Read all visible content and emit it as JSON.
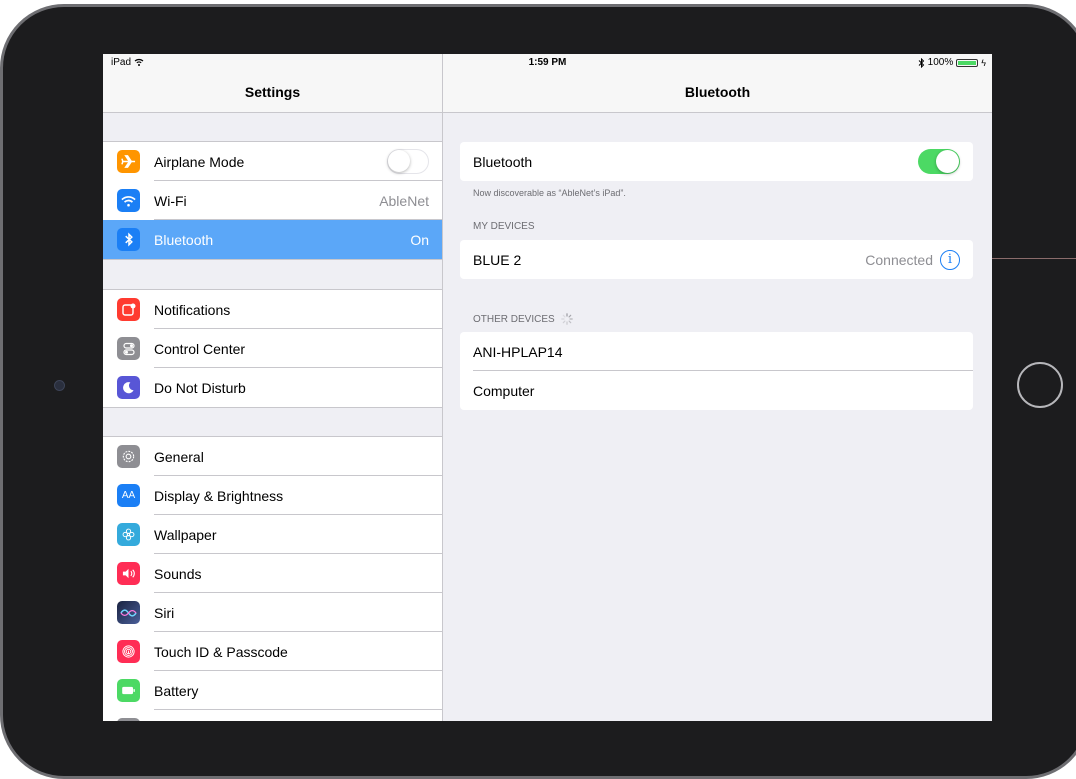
{
  "status_bar": {
    "device": "iPad",
    "time": "1:59 PM",
    "battery": "100%",
    "battery_level": 1.0
  },
  "master": {
    "title": "Settings",
    "groups": [
      [
        {
          "label": "Airplane Mode",
          "icon": "airplane-icon",
          "color": "#ff9500",
          "toggle": "off"
        },
        {
          "label": "Wi-Fi",
          "icon": "wifi-icon",
          "color": "#1b7ff5",
          "value": "AbleNet"
        },
        {
          "label": "Bluetooth",
          "icon": "bluetooth-icon",
          "color": "#1b7ff5",
          "value": "On",
          "selected": true
        }
      ],
      [
        {
          "label": "Notifications",
          "icon": "notifications-icon",
          "color": "#ff3b30"
        },
        {
          "label": "Control Center",
          "icon": "control-center-icon",
          "color": "#8e8e93"
        },
        {
          "label": "Do Not Disturb",
          "icon": "moon-icon",
          "color": "#5856d6"
        }
      ],
      [
        {
          "label": "General",
          "icon": "gear-icon",
          "color": "#8e8e93"
        },
        {
          "label": "Display & Brightness",
          "icon": "display-icon",
          "color": "#1b7ff5"
        },
        {
          "label": "Wallpaper",
          "icon": "wallpaper-icon",
          "color": "#34aadc"
        },
        {
          "label": "Sounds",
          "icon": "sounds-icon",
          "color": "#ff2d55"
        },
        {
          "label": "Siri",
          "icon": "siri-icon",
          "color": "#2d3a5c"
        },
        {
          "label": "Touch ID & Passcode",
          "icon": "fingerprint-icon",
          "color": "#ff2d55"
        },
        {
          "label": "Battery",
          "icon": "battery-icon",
          "color": "#4cd964"
        }
      ]
    ]
  },
  "detail": {
    "title": "Bluetooth",
    "toggle_label": "Bluetooth",
    "toggle_state": "on",
    "discoverable_note": "Now discoverable as “AbleNet’s iPad”.",
    "my_devices_header": "MY DEVICES",
    "my_devices": [
      {
        "name": "BLUE 2",
        "status": "Connected"
      }
    ],
    "other_devices_header": "OTHER DEVICES",
    "other_devices": [
      {
        "name": "ANI-HPLAP14"
      },
      {
        "name": "Computer"
      }
    ]
  }
}
